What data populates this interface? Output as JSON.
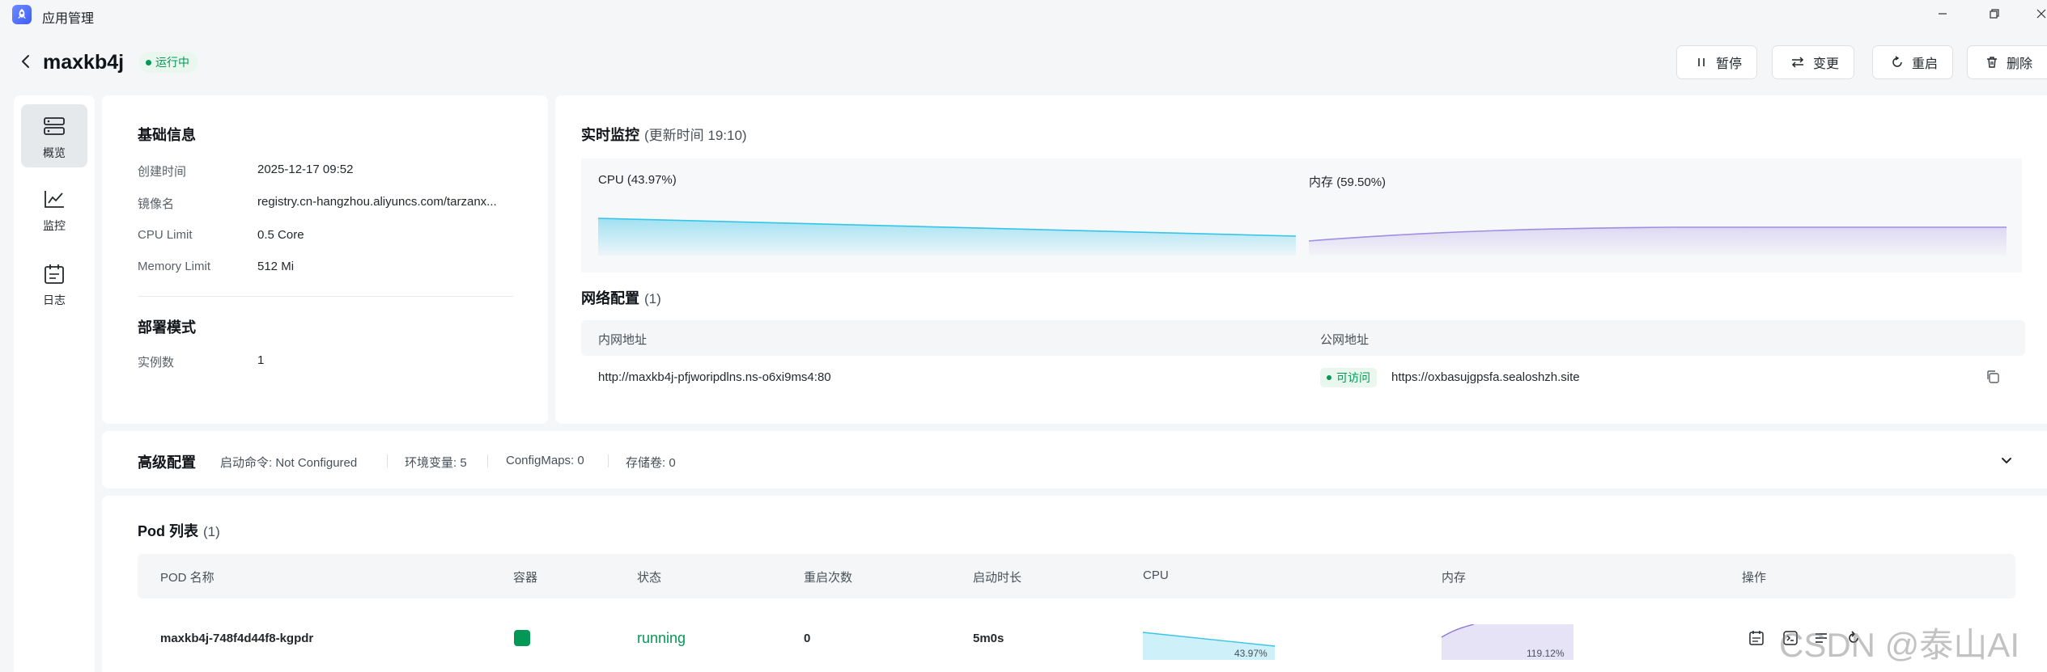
{
  "window": {
    "title": "应用管理"
  },
  "header": {
    "app_name": "maxkb4j",
    "status": "运行中",
    "buttons": {
      "pause": "暂停",
      "change": "变更",
      "restart": "重启",
      "delete": "删除"
    }
  },
  "sidebar": {
    "items": [
      {
        "label": "概览",
        "active": true
      },
      {
        "label": "监控"
      },
      {
        "label": "日志"
      }
    ]
  },
  "basic_info": {
    "title": "基础信息",
    "rows": [
      {
        "key": "创建时间",
        "value": "2025-12-17 09:52"
      },
      {
        "key": "镜像名",
        "value": "registry.cn-hangzhou.aliyuncs.com/tarzanx..."
      },
      {
        "key": "CPU Limit",
        "value": "0.5 Core"
      },
      {
        "key": "Memory Limit",
        "value": "512 Mi"
      }
    ]
  },
  "deploy": {
    "title": "部署模式",
    "rows": [
      {
        "key": "实例数",
        "value": "1"
      }
    ]
  },
  "monitor": {
    "title": "实时监控",
    "update": "(更新时间  19:10)",
    "cpu_label": "CPU",
    "cpu_value": "(43.97%)",
    "mem_label": "内存",
    "mem_value": "(59.50%)",
    "cpu_color": "#36c5e8",
    "mem_color": "#a18ee0"
  },
  "network": {
    "title": "网络配置",
    "count": "(1)",
    "headers": {
      "internal": "内网地址",
      "public": "公网地址"
    },
    "internal_url": "http://maxkb4j-pfjworipdlns.ns-o6xi9ms4:80",
    "public_status": "可访问",
    "public_url": "https://oxbasujgpsfa.sealoshzh.site"
  },
  "advanced": {
    "title": "高级配置",
    "items": [
      "启动命令: Not Configured",
      "环境变量: 5",
      "ConfigMaps: 0",
      "存储卷: 0"
    ]
  },
  "pods": {
    "title": "Pod 列表",
    "count": "(1)",
    "headers": {
      "name": "POD 名称",
      "container": "容器",
      "status": "状态",
      "restarts": "重启次数",
      "uptime": "启动时长",
      "cpu": "CPU",
      "mem": "内存",
      "ops": "操作"
    },
    "rows": [
      {
        "name": "maxkb4j-748f4d44f8-kgpdr",
        "status": "running",
        "restarts": "0",
        "uptime": "5m0s",
        "cpu": "43.97%",
        "mem": "119.12%"
      }
    ]
  },
  "watermark": "CSDN @泰山AI"
}
